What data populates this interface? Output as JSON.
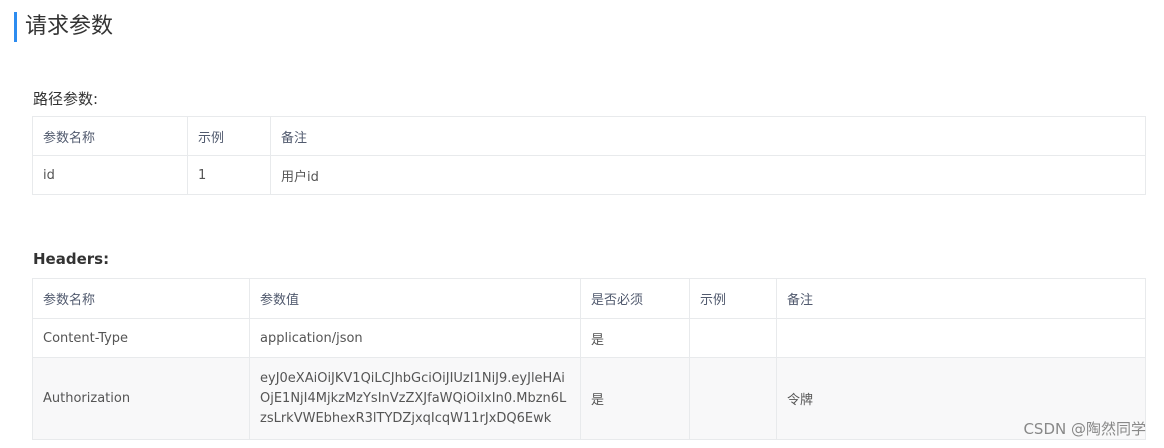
{
  "section": {
    "title": "请求参数"
  },
  "path_params": {
    "title": "路径参数:",
    "columns": [
      "参数名称",
      "示例",
      "备注"
    ],
    "rows": [
      [
        "id",
        "1",
        "用户id"
      ]
    ]
  },
  "headers": {
    "title": "Headers:",
    "columns": [
      "参数名称",
      "参数值",
      "是否必须",
      "示例",
      "备注"
    ],
    "rows": [
      [
        "Content-Type",
        "application/json",
        "是",
        "",
        ""
      ],
      [
        "Authorization",
        "eyJ0eXAiOiJKV1QiLCJhbGciOiJIUzI1NiJ9.eyJleHAiOjE1NjI4MjkzMzYsInVzZXJfaWQiOiIxIn0.Mbzn6LzsLrkVWEbhexR3lTYDZjxqIcqW11rJxDQ6Ewk",
        "是",
        "",
        "令牌"
      ]
    ]
  },
  "watermark": "CSDN @陶然同学"
}
